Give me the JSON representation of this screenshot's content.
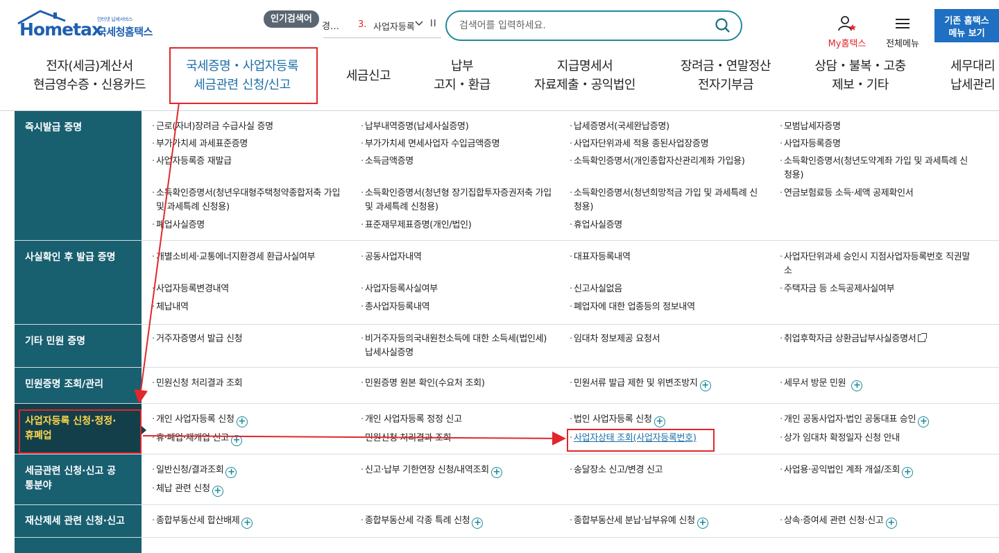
{
  "header": {
    "logo_brand": "Hometax",
    "logo_sub_small": "인터넷 납세서비스",
    "logo_agency": "국세청홈택스",
    "popular_badge": "인기검색어",
    "popular_fragment": "경…",
    "popular_rank": "3.",
    "popular_text": "사업자등록",
    "popular_pause": "II",
    "search_placeholder": "검색어를 입력하세요.",
    "my_hometax": "My홈택스",
    "all_menu": "전체메뉴",
    "old_hometax_line1": "기존 홈택스",
    "old_hometax_line2": "메뉴 보기"
  },
  "gnb": [
    {
      "line1": "전자(세금)계산서",
      "line2": "현금영수증・신용카드"
    },
    {
      "line1": "국세증명・사업자등록",
      "line2": "세금관련 신청/신고"
    },
    {
      "line1": "세금신고",
      "line2": ""
    },
    {
      "line1": "납부",
      "line2": "고지・환급"
    },
    {
      "line1": "지급명세서",
      "line2": "자료제출・공익법인"
    },
    {
      "line1": "장려금・연말정산",
      "line2": "전자기부금"
    },
    {
      "line1": "상담・불복・고충",
      "line2": "제보・기타"
    },
    {
      "line1": "세무대리",
      "line2": "납세관리"
    }
  ],
  "categories": [
    {
      "label": "즉시발급 증명"
    },
    {
      "label": "사실확인 후 발급 증명"
    },
    {
      "label": "기타 민원 증명"
    },
    {
      "label": "민원증명 조회/관리"
    },
    {
      "label": "사업자등록 신청·정정·휴폐업"
    },
    {
      "label": "세금관련 신청·신고 공통분야"
    },
    {
      "label": "재산제세 관련 신청·신고"
    }
  ],
  "items": {
    "r1": [
      "근로(자녀)장려금 수급사실 증명",
      "납부내역증명(납세사실증명)",
      "납세증명서(국세완납증명)",
      "모범납세자증명",
      "부가가치세 과세표준증명",
      "부가가치세 면세사업자 수입금액증명",
      "사업자단위과세 적용 종된사업장증명",
      "사업자등록증명",
      "사업자등록증 재발급",
      "소득금액증명",
      "소득확인증명서(개인종합자산관리계좌 가입용)",
      "소득확인증명서(청년도약계좌 가입 및 과세특례 신",
      "청용)",
      "소득확인증명서(청년우대형주택청약종합저축 가입",
      "소득확인증명서(청년형 장기집합투자증권저축 가입",
      "소득확인증명서(청년희망적금 가입 및 과세특례 신",
      "연금보험료등 소득·세액 공제확인서",
      "및 과세특례 신청용)",
      "및 과세특례 신청용)",
      "청용)",
      "폐업사실증명",
      "표준재무제표증명(개인/법인)",
      "휴업사실증명"
    ],
    "r2": [
      "개별소비세·교통에너지환경세 환급사실여부",
      "공동사업자내역",
      "대표자등록내역",
      "사업자단위과세 승인시 지점사업자등록번호 직권말",
      "소",
      "사업자등록변경내역",
      "사업자등록사실여부",
      "신고사실없음",
      "주택자금 등 소득공제사실여부",
      "체납내역",
      "총사업자등록내역",
      "폐업자에 대한 업종등의 정보내역"
    ],
    "r3": [
      "거주자증명서 발급 신청",
      "비거주자등의국내원천소득에 대한 소득세(법인세)",
      "임대차 정보제공 요청서",
      "취업후학자금 상환금납부사실증명서",
      "납세사실증명"
    ],
    "r4": [
      "민원신청 처리결과 조회",
      "민원증명 원본 확인(수요처 조회)",
      "민원서류 발급 제한 및 위변조방지",
      "세무서 방문 민원"
    ],
    "r5": [
      "개인 사업자등록 신청",
      "개인 사업자등록 정정 신고",
      "법인 사업자등록 신청",
      "개인 공동사업자·법인 공동대표 승인",
      "휴·폐업·재개업 신고",
      "민원신청 처리결과 조회",
      "사업자상태 조회(사업자등록번호)",
      "상가 임대차 확정일자 신청 안내"
    ],
    "r6": [
      "일반신청/결과조회",
      "신고·납부 기한연장 신청/내역조회",
      "송달장소 신고/변경 신고",
      "사업용·공익법인 계좌 개설/조회",
      "체납 관련 신청"
    ],
    "r7": [
      "종합부동산세 합산배제",
      "종합부동산세 각종 특례 신청",
      "종합부동산세 분납·납부유예 신청",
      "상속·증여세 관련 신청·신고"
    ]
  },
  "colors": {
    "teal": "#185f70",
    "teal_active": "#133f4a",
    "highlight_text": "#ffd84a",
    "annotation_red": "#e3262b",
    "link_blue": "#1b6fa8"
  }
}
